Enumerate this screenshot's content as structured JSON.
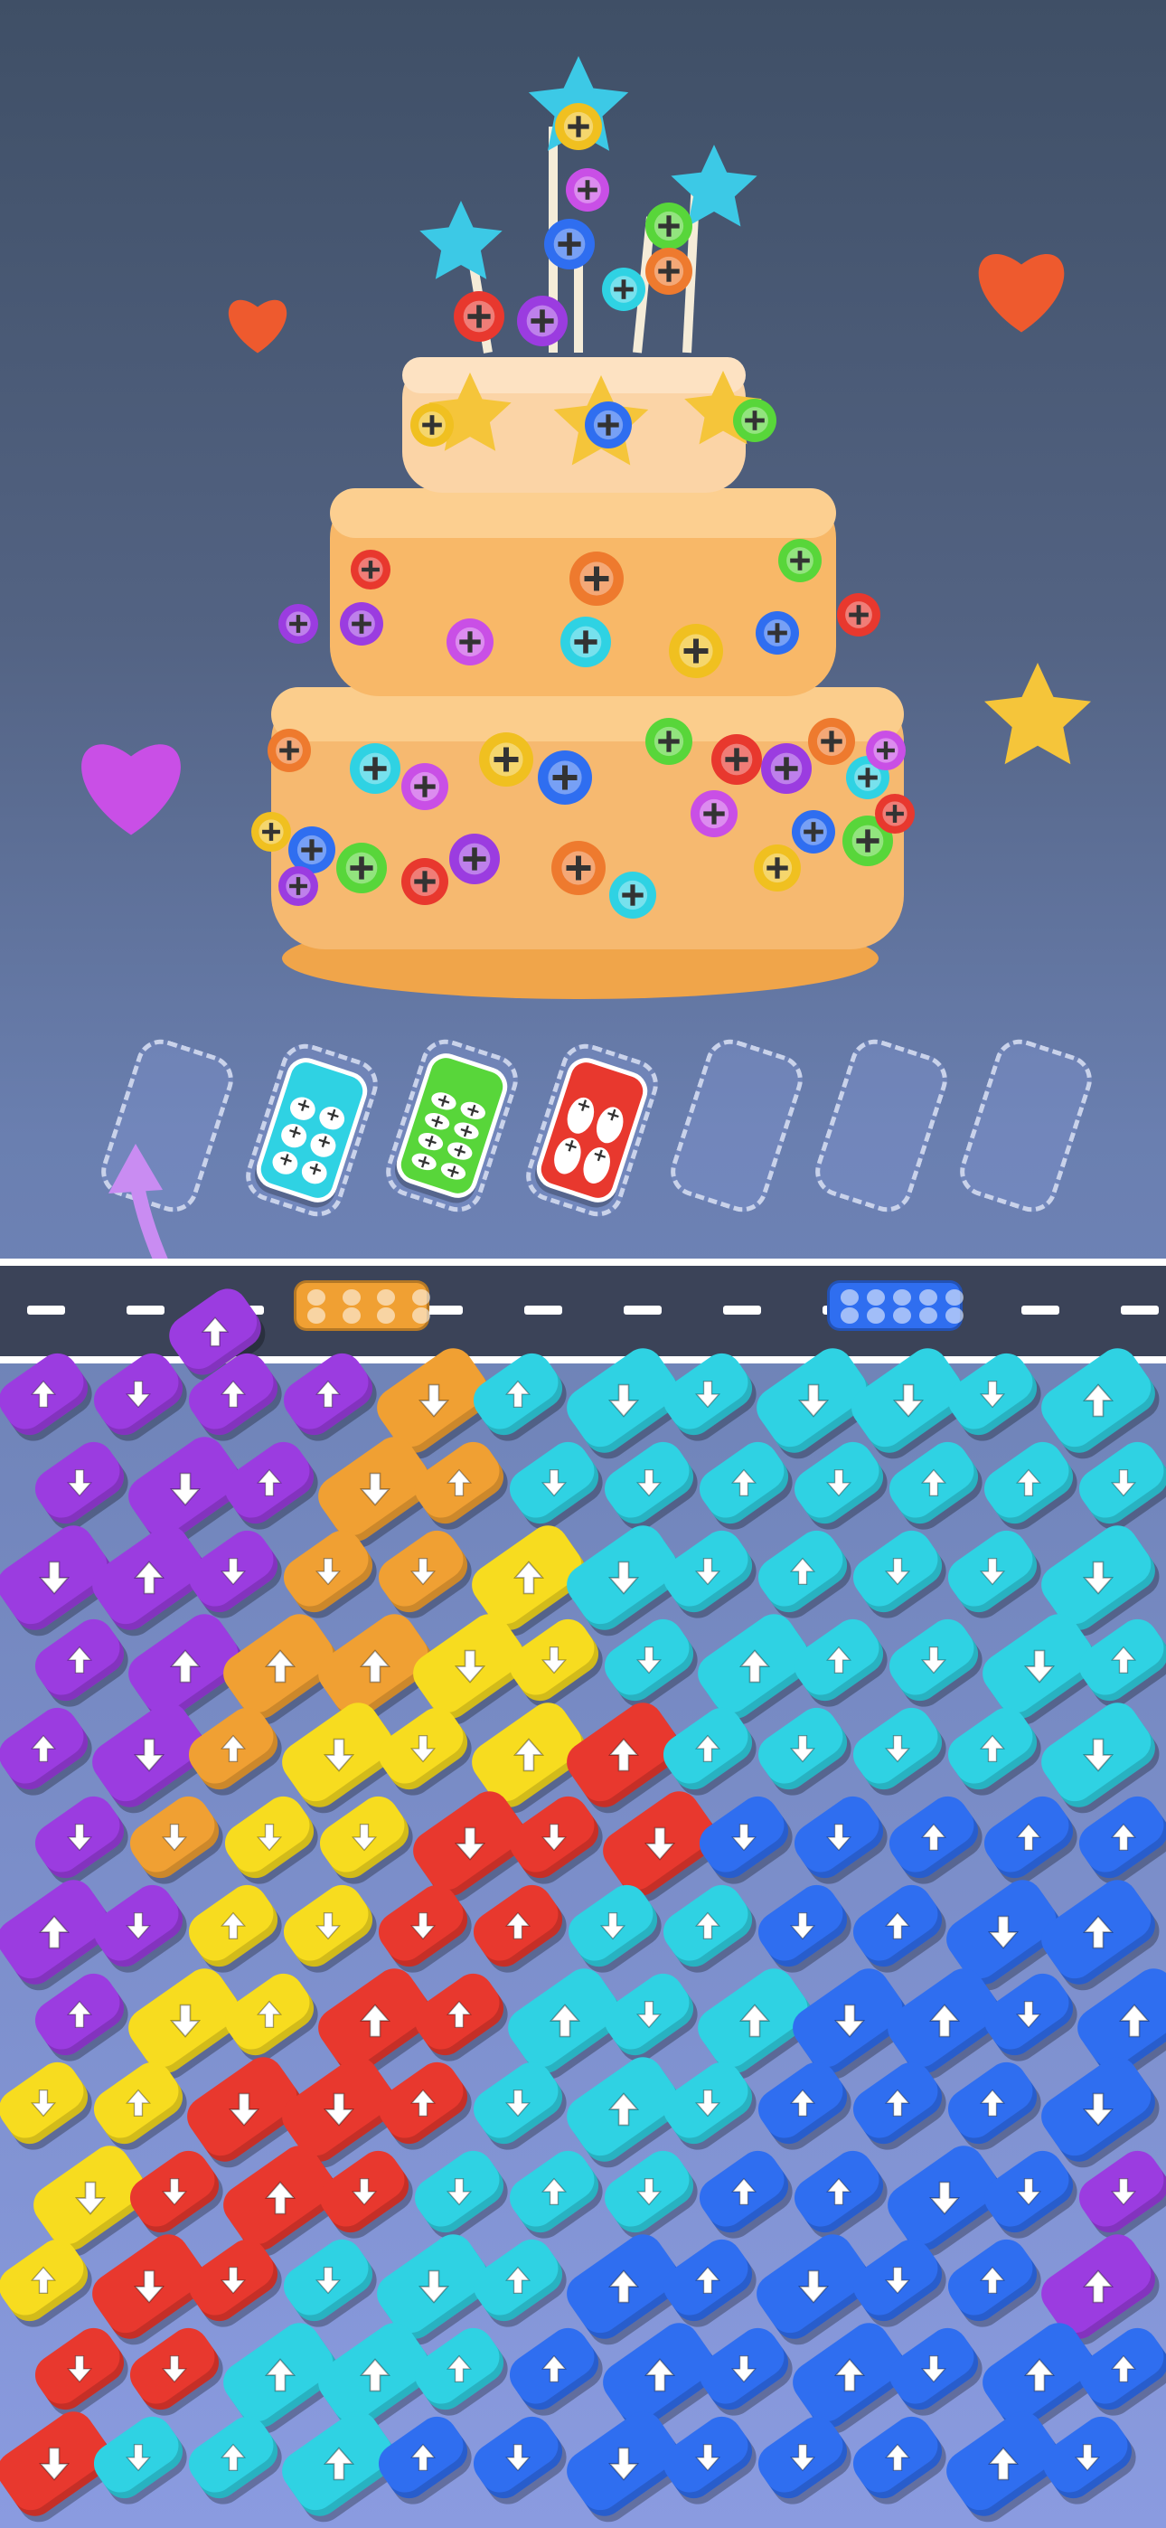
{
  "colors": {
    "purple": "#9b3ce0",
    "orange": "#f0a033",
    "yellow": "#f7dc1f",
    "red": "#e8382e",
    "cyan": "#2fd2e3",
    "blue": "#2f6ef0",
    "green": "#58d63a",
    "slot_border": "#c9d2ea",
    "road": "#3b4358"
  },
  "icons": {
    "cake": "layered-cake-icon",
    "heart": "heart-icon",
    "star": "star-icon",
    "screw": "screw-icon",
    "arrow": "arrow-icon"
  },
  "slots": [
    {
      "state": "empty"
    },
    {
      "state": "car",
      "color": "cyan",
      "seats_total": 6,
      "seats_filled": 6
    },
    {
      "state": "car",
      "color": "green",
      "seats_total": 8,
      "seats_filled": 8
    },
    {
      "state": "car",
      "color": "red",
      "seats_total": 4,
      "seats_filled": 4
    },
    {
      "state": "empty"
    },
    {
      "state": "empty"
    },
    {
      "state": "empty"
    }
  ],
  "road_vehicles": [
    {
      "color": "orange",
      "seats": 8
    },
    {
      "color": "blue",
      "seats": 10
    },
    {
      "color": "purple",
      "seats": 0,
      "note_direction": "up"
    }
  ]
}
